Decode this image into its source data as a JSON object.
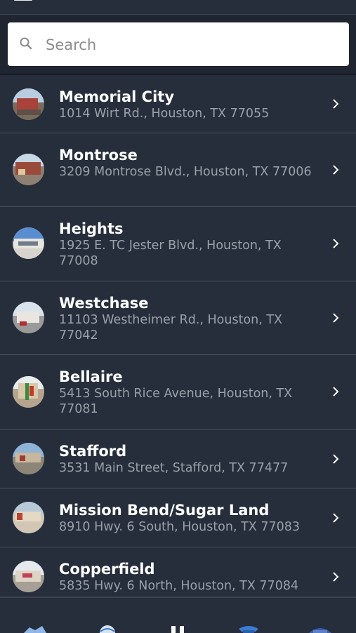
{
  "search": {
    "placeholder": "Search"
  },
  "colors": {
    "background": "#262e3b",
    "text_primary": "#ffffff",
    "text_secondary": "#9aa1aa",
    "accent": "#3a7bd5"
  },
  "locations": [
    {
      "name": "Memorial City",
      "address": "1014 Wirt Rd., Houston, TX 77055"
    },
    {
      "name": "Montrose",
      "address": "3209 Montrose Blvd., Houston, TX 77006"
    },
    {
      "name": "Heights",
      "address": "1925 E. TC Jester Blvd., Houston, TX 77008"
    },
    {
      "name": "Westchase",
      "address": "11103 Westheimer Rd., Houston, TX 77042"
    },
    {
      "name": "Bellaire",
      "address": "5413 South Rice Avenue, Houston, TX 77081"
    },
    {
      "name": "Stafford",
      "address": "3531 Main Street, Stafford, TX 77477"
    },
    {
      "name": "Mission Bend/Sugar Land",
      "address": "8910 Hwy. 6 South, Houston, TX 77083"
    },
    {
      "name": "Copperfield",
      "address": "5835 Hwy. 6 North, Houston, TX 77084"
    }
  ],
  "bottom_tabs": [
    {
      "icon": "map-icon"
    },
    {
      "icon": "globe-icon"
    },
    {
      "icon": "pause-icon"
    },
    {
      "icon": "phone-icon"
    },
    {
      "icon": "card-icon"
    }
  ]
}
